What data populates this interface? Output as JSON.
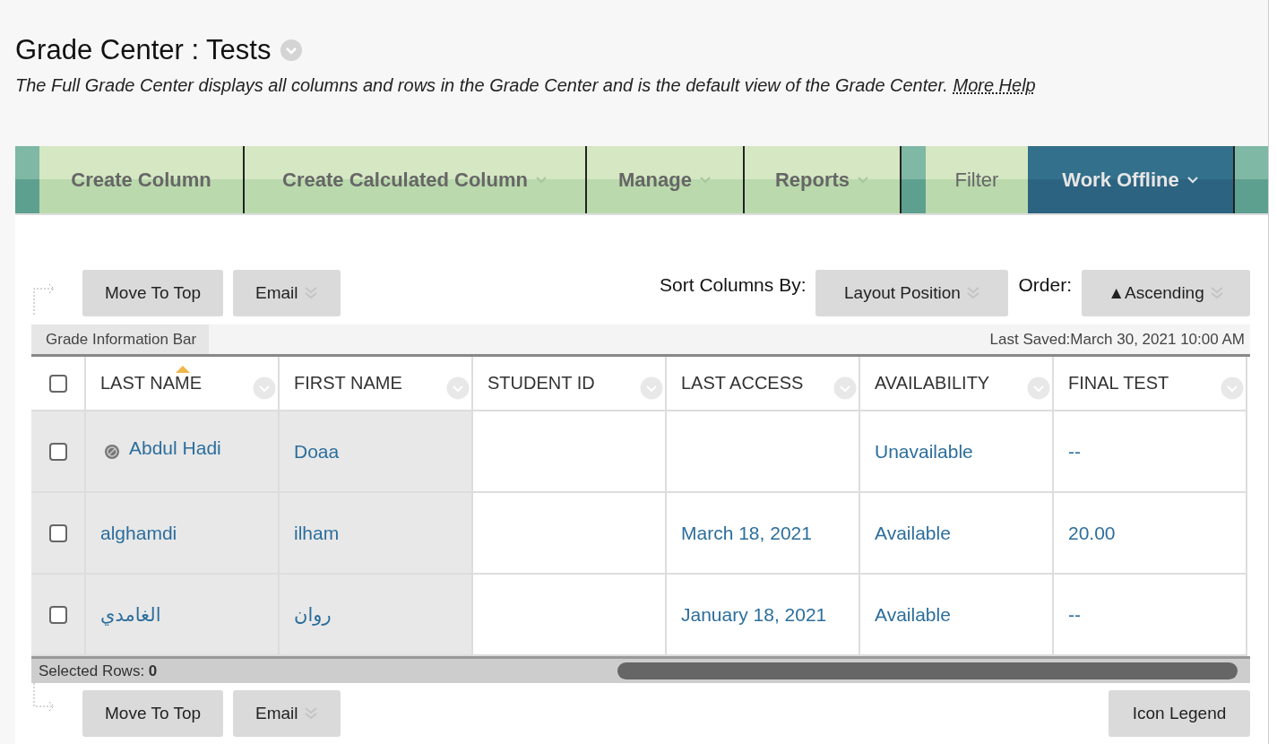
{
  "page": {
    "title": "Grade Center : Tests",
    "description": "The Full Grade Center displays all columns and rows in the Grade Center and is the default view of the Grade Center.",
    "help_link": "More Help"
  },
  "action_bar": [
    {
      "label": "Create Column",
      "kind": "action",
      "has_caret": false,
      "selected": false
    },
    {
      "label": "Create Calculated Column",
      "kind": "action",
      "has_caret": true,
      "selected": false
    },
    {
      "label": "Manage",
      "kind": "action",
      "has_caret": true,
      "selected": false
    },
    {
      "label": "Reports",
      "kind": "action",
      "has_caret": true,
      "selected": false
    },
    {
      "label": "Filter",
      "kind": "filter",
      "has_caret": false,
      "selected": false
    },
    {
      "label": "Work Offline",
      "kind": "action",
      "has_caret": true,
      "selected": true
    }
  ],
  "top_toolbar": {
    "buttons": [
      {
        "label": "Move To Top",
        "has_caret": false
      },
      {
        "label": "Email",
        "has_caret": true
      }
    ],
    "sort_label": "Sort Columns By:",
    "sort_value": "Layout Position",
    "order_label": "Order:",
    "order_value": "▲Ascending"
  },
  "info_bar": {
    "tab": "Grade Information Bar",
    "last_saved": "Last Saved:March 30, 2021 10:00 AM"
  },
  "table": {
    "select_all_checked": false,
    "columns": [
      {
        "label": "LAST NAME",
        "sorted": true
      },
      {
        "label": "FIRST NAME",
        "sorted": false
      },
      {
        "label": "STUDENT ID",
        "sorted": false
      },
      {
        "label": "LAST ACCESS",
        "sorted": false
      },
      {
        "label": "AVAILABILITY",
        "sorted": false
      },
      {
        "label": "FINAL TEST",
        "sorted": false
      }
    ],
    "rows": [
      {
        "checked": false,
        "unavailable": true,
        "cells": [
          "Abdul Hadi",
          "Doaa",
          null,
          null,
          "Unavailable",
          "--"
        ]
      },
      {
        "checked": false,
        "unavailable": false,
        "cells": [
          "alghamdi",
          "ilham",
          null,
          "March 18, 2021",
          "Available",
          "20.00"
        ]
      },
      {
        "checked": false,
        "unavailable": false,
        "cells": [
          "الغامدي",
          "روان",
          null,
          "January 18, 2021",
          "Available",
          "--"
        ]
      }
    ]
  },
  "selected_rows": "Selected Rows: **0**",
  "bottom_toolbar": {
    "buttons": [
      {
        "label": "Move To Top",
        "has_caret": false
      },
      {
        "label": "Email",
        "has_caret": true
      }
    ],
    "legend": "Icon Legend"
  }
}
